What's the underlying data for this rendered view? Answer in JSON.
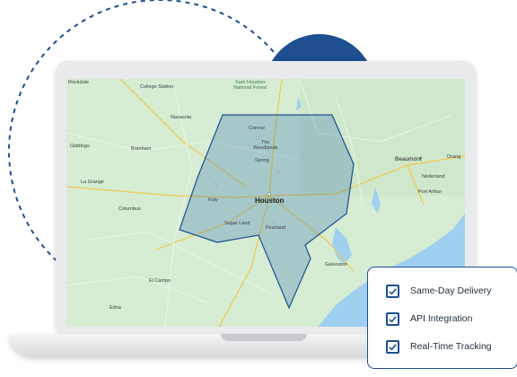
{
  "colors": {
    "brand_blue": "#1d4f91",
    "map_land": "#d6ecd3",
    "map_water": "#9fd0f0",
    "zone_fill": "#2b6cb0"
  },
  "map": {
    "labels": {
      "rockdale": "Rockdale",
      "college_station": "College Station",
      "sam_houston_1": "Sam Houston",
      "sam_houston_2": "National Forest",
      "navasota": "Navasota",
      "conroe": "Conroe",
      "the_woodlands_1": "The",
      "the_woodlands_2": "Woodlands",
      "giddings": "Giddings",
      "brenham": "Brenham",
      "spring": "Spring",
      "beaumont": "Beaumont",
      "orange": "Orang",
      "nederland": "Nederland",
      "la_grange": "La Grange",
      "katy": "Katy",
      "houston": "Houston",
      "port_arthur": "Port Arthur",
      "columbus": "Columbus",
      "sugar_land": "Sugar Land",
      "pearland": "Pearland",
      "galveston": "Galveston",
      "el_campo": "El Campo",
      "edna": "Edna"
    }
  },
  "features": [
    {
      "label": "Same-Day Delivery",
      "icon": "checkbox-checked-icon"
    },
    {
      "label": "API Integration",
      "icon": "checkbox-checked-icon"
    },
    {
      "label": "Real-Time Tracking",
      "icon": "checkbox-checked-icon"
    }
  ]
}
